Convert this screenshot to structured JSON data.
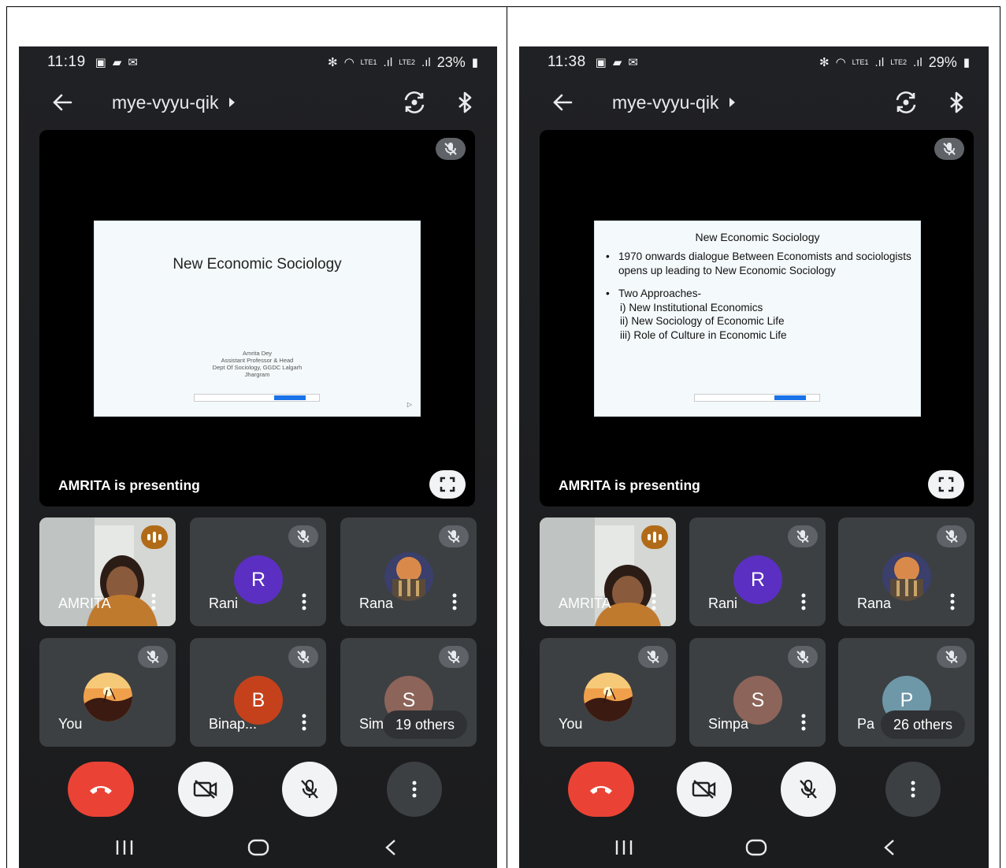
{
  "screens": [
    {
      "status": {
        "time": "11:19",
        "battery": "23%",
        "network_1": "LTE1",
        "network_2": "LTE2"
      },
      "meeting": {
        "code": "mye-vyyu-qik"
      },
      "presentation": {
        "presenting_label": "AMRITA is presenting",
        "slide_title": "New Economic Sociology",
        "credits": [
          "Amrita Dey",
          "Assistant Professor & Head",
          "Dept Of Sociology, GGDC Lalgarh",
          "Jhargram"
        ]
      },
      "tiles": [
        {
          "name": "AMRITA"
        },
        {
          "name": "Rani",
          "initial": "R",
          "color": "#5b2fc2"
        },
        {
          "name": "Rana"
        },
        {
          "name": "You"
        },
        {
          "name": "Binap...",
          "initial": "B",
          "color": "#c5411c"
        },
        {
          "name": "Sim",
          "initial": "S",
          "color": "#8d6459",
          "others": "19 others"
        }
      ]
    },
    {
      "status": {
        "time": "11:38",
        "battery": "29%",
        "network_1": "LTE1",
        "network_2": "LTE2"
      },
      "meeting": {
        "code": "mye-vyyu-qik"
      },
      "presentation": {
        "presenting_label": "AMRITA is presenting",
        "slide_title": "New Economic Sociology",
        "bullet_1": "1970 onwards dialogue  Between Economists and sociologists opens up leading to New Economic Sociology",
        "bullet_2": "Two Approaches-",
        "sub_1": "i) New Institutional Economics",
        "sub_2": "ii) New Sociology of Economic Life",
        "sub_3": "iii) Role of Culture in Economic Life"
      },
      "tiles": [
        {
          "name": "AMRITA"
        },
        {
          "name": "Rani",
          "initial": "R",
          "color": "#5b2fc2"
        },
        {
          "name": "Rana"
        },
        {
          "name": "You"
        },
        {
          "name": "Simpa",
          "initial": "S",
          "color": "#8d6459"
        },
        {
          "name": "Pa",
          "initial": "P",
          "color": "#6e97a8",
          "others": "26 others"
        }
      ]
    }
  ]
}
